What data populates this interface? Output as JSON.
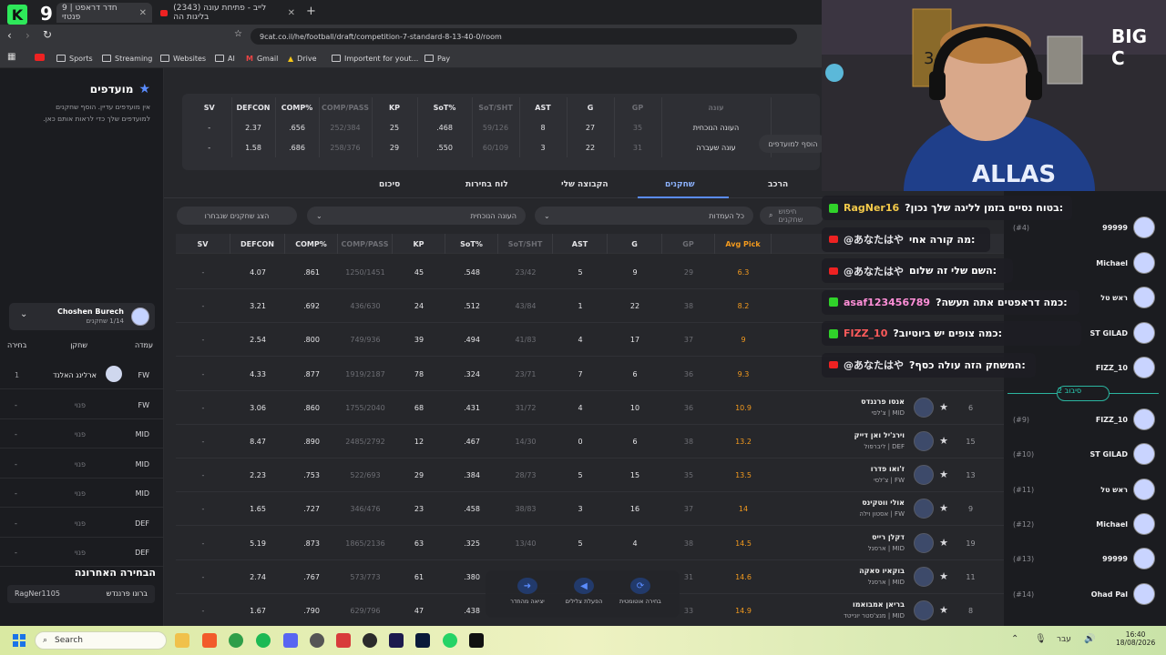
{
  "browser": {
    "tabs": [
      {
        "title": "חדר דראפט | 9 פנטזי",
        "active": true
      },
      {
        "title": "(2343) לייב - פתיחת עונה בליגות הה",
        "active": false
      }
    ],
    "url": "9cat.co.il/he/football/draft/competition-7-standard-8-13-40-0/room",
    "bookmarks": [
      "Sports",
      "Streaming",
      "Websites",
      "AI",
      "Gmail",
      "Drive",
      "Importent for yout...",
      "Pay"
    ]
  },
  "favorites": {
    "title": "מועדפים",
    "empty_text_1": "אין מועדפים עדיין. הוסף שחקנים",
    "empty_text_2": "למועדפים שלך כדי לראות אותם כאן.",
    "add_fav_label": "הוסף למועדפים"
  },
  "team_box": {
    "owner": "Choshen Burech",
    "sub": "1/14 שחקנים",
    "headers": {
      "pos": "עמדה",
      "player": "שחקן",
      "pick": "בחירה"
    },
    "rows": [
      {
        "pos": "FW",
        "player": "ארלינג האלנד",
        "pick": "1"
      },
      {
        "pos": "FW",
        "player": "פנוי",
        "pick": "-"
      },
      {
        "pos": "MID",
        "player": "פנוי",
        "pick": "-"
      },
      {
        "pos": "MID",
        "player": "פנוי",
        "pick": "-"
      },
      {
        "pos": "MID",
        "player": "פנוי",
        "pick": "-"
      },
      {
        "pos": "DEF",
        "player": "פנוי",
        "pick": "-"
      },
      {
        "pos": "DEF",
        "player": "פנוי",
        "pick": "-"
      }
    ]
  },
  "last_pick": {
    "title": "הבחירה האחרונה",
    "player": "ברונו פרננדש",
    "user": "RagNer1105"
  },
  "summary_stats": {
    "headers": [
      "SV",
      "DEFCON",
      "COMP%",
      "COMP/PASS",
      "KP",
      "SoT%",
      "SoT/SHT",
      "AST",
      "G",
      "GP",
      "עונה"
    ],
    "rows": [
      [
        "-",
        "2.37",
        ".656",
        "252/384",
        "25",
        ".468",
        "59/126",
        "8",
        "27",
        "35",
        "העונה הנוכחית"
      ],
      [
        "-",
        "1.58",
        ".686",
        "258/376",
        "29",
        ".550",
        "60/109",
        "3",
        "22",
        "31",
        "עונה שעברה"
      ]
    ]
  },
  "nav_tabs": [
    "סיכום",
    "לוח בחירות",
    "הקבוצה שלי",
    "שחקנים",
    "הרכב"
  ],
  "active_tab": "שחקנים",
  "filters": {
    "show_picked": "הצג שחקנים שנבחרו",
    "season": "העונה הנוכחית",
    "positions": "כל העמדות",
    "search_placeholder": "חיפוש שחקנים"
  },
  "players_table": {
    "headers": [
      "SV",
      "DEFCON",
      "COMP%",
      "COMP/PASS",
      "KP",
      "SoT%",
      "SoT/SHT",
      "AST",
      "G",
      "GP",
      "Avg Pick"
    ],
    "rows": [
      {
        "sv": "-",
        "defcon": "4.07",
        "comp": ".861",
        "cp": "1250/1451",
        "kp": "45",
        "sot": ".548",
        "ss": "23/42",
        "ast": "5",
        "g": "9",
        "gp": "29",
        "avg": "6.3",
        "rank": "",
        "name": "",
        "team": ""
      },
      {
        "sv": "-",
        "defcon": "3.21",
        "comp": ".692",
        "cp": "436/630",
        "kp": "24",
        "sot": ".512",
        "ss": "43/84",
        "ast": "1",
        "g": "22",
        "gp": "38",
        "avg": "8.2",
        "rank": "",
        "name": "",
        "team": ""
      },
      {
        "sv": "-",
        "defcon": "2.54",
        "comp": ".800",
        "cp": "749/936",
        "kp": "39",
        "sot": ".494",
        "ss": "41/83",
        "ast": "4",
        "g": "17",
        "gp": "37",
        "avg": "9",
        "rank": "",
        "name": "",
        "team": ""
      },
      {
        "sv": "-",
        "defcon": "4.33",
        "comp": ".877",
        "cp": "1919/2187",
        "kp": "78",
        "sot": ".324",
        "ss": "23/71",
        "ast": "7",
        "g": "6",
        "gp": "36",
        "avg": "9.3",
        "rank": "",
        "name": "",
        "team": ""
      },
      {
        "sv": "-",
        "defcon": "3.06",
        "comp": ".860",
        "cp": "1755/2040",
        "kp": "68",
        "sot": ".431",
        "ss": "31/72",
        "ast": "4",
        "g": "10",
        "gp": "36",
        "avg": "10.9",
        "rank": "6",
        "name": "אנסו פרננדס",
        "team": "צ'לסי | MID"
      },
      {
        "sv": "-",
        "defcon": "8.47",
        "comp": ".890",
        "cp": "2485/2792",
        "kp": "12",
        "sot": ".467",
        "ss": "14/30",
        "ast": "0",
        "g": "6",
        "gp": "38",
        "avg": "13.2",
        "rank": "15",
        "name": "וירג'יל ואן דייק",
        "team": "ליברפול | DEF"
      },
      {
        "sv": "-",
        "defcon": "2.23",
        "comp": ".753",
        "cp": "522/693",
        "kp": "29",
        "sot": ".384",
        "ss": "28/73",
        "ast": "5",
        "g": "15",
        "gp": "35",
        "avg": "13.5",
        "rank": "13",
        "name": "ז'ואו פדרו",
        "team": "צ'לסי | FW"
      },
      {
        "sv": "-",
        "defcon": "1.65",
        "comp": ".727",
        "cp": "346/476",
        "kp": "23",
        "sot": ".458",
        "ss": "38/83",
        "ast": "3",
        "g": "16",
        "gp": "37",
        "avg": "14",
        "rank": "9",
        "name": "אולי ווטקינס",
        "team": "אסטון וילה | FW"
      },
      {
        "sv": "-",
        "defcon": "5.19",
        "comp": ".873",
        "cp": "1865/2136",
        "kp": "63",
        "sot": ".325",
        "ss": "13/40",
        "ast": "5",
        "g": "4",
        "gp": "38",
        "avg": "14.5",
        "rank": "19",
        "name": "דקלן רייס",
        "team": "ארסנל | MID"
      },
      {
        "sv": "-",
        "defcon": "2.74",
        "comp": ".767",
        "cp": "573/773",
        "kp": "61",
        "sot": ".380",
        "ss": "",
        "ast": "",
        "g": "",
        "gp": "31",
        "avg": "14.6",
        "rank": "11",
        "name": "בוקאיו סאקה",
        "team": "ארסנל | MID"
      },
      {
        "sv": "-",
        "defcon": "1.67",
        "comp": ".790",
        "cp": "629/796",
        "kp": "47",
        "sot": ".438",
        "ss": "",
        "ast": "",
        "g": "",
        "gp": "33",
        "avg": "14.9",
        "rank": "8",
        "name": "בריאן אמבואמו",
        "team": "מנצ'סטר יונייטד | MID"
      }
    ]
  },
  "controls": {
    "leave": "יציאה מהחדר",
    "sounds": "הפעלת צלילים",
    "auto": "בחירה אוטומטית"
  },
  "right_rankings": {
    "top": [
      {
        "rank": "(#4)",
        "name": "99999"
      },
      {
        "rank": "",
        "name": "Michael"
      },
      {
        "rank": "",
        "name": "ראש טל"
      },
      {
        "rank": "",
        "name": "ST GILAD"
      },
      {
        "rank": "",
        "name": "FIZZ_10"
      }
    ],
    "round_label": "סיבוב 2",
    "bottom": [
      {
        "rank": "(#9)",
        "name": "FIZZ_10"
      },
      {
        "rank": "(#10)",
        "name": "ST GILAD"
      },
      {
        "rank": "(#11)",
        "name": "ראש טל"
      },
      {
        "rank": "(#12)",
        "name": "Michael"
      },
      {
        "rank": "(#13)",
        "name": "99999"
      },
      {
        "rank": "(#14)",
        "name": "Ohad Pal"
      }
    ]
  },
  "chat": [
    {
      "src": "kick",
      "user": "RagNer16",
      "text": ":בטוח נסיים בזמן לליגה שלך נכון?",
      "ucolor": "#f3c94a"
    },
    {
      "src": "yt",
      "user": "@あなたはや",
      "text": ":מה קורה אחי",
      "ucolor": "#e6e6ea"
    },
    {
      "src": "yt",
      "user": "@あなたはや",
      "text": ":השם שלי זה שלום",
      "ucolor": "#e6e6ea"
    },
    {
      "src": "kick",
      "user": "asaf123456789",
      "text": ":כמה דראפטים אתה תעשה?",
      "ucolor": "#ff8fd8"
    },
    {
      "src": "kick",
      "user": "FIZZ_10",
      "text": ":כמה צופים יש ביוטיוב?",
      "ucolor": "#ff5b5b"
    },
    {
      "src": "yt",
      "user": "@あなたはや",
      "text": ":המשחק הזה עולה כסף?",
      "ucolor": "#e6e6ea"
    }
  ],
  "logo": {
    "site_number": "9",
    "stream_logo": "BIG C"
  },
  "taskbar": {
    "search": "Search",
    "time": "16:40",
    "date": "18/08/2026",
    "lang": "עבר"
  }
}
